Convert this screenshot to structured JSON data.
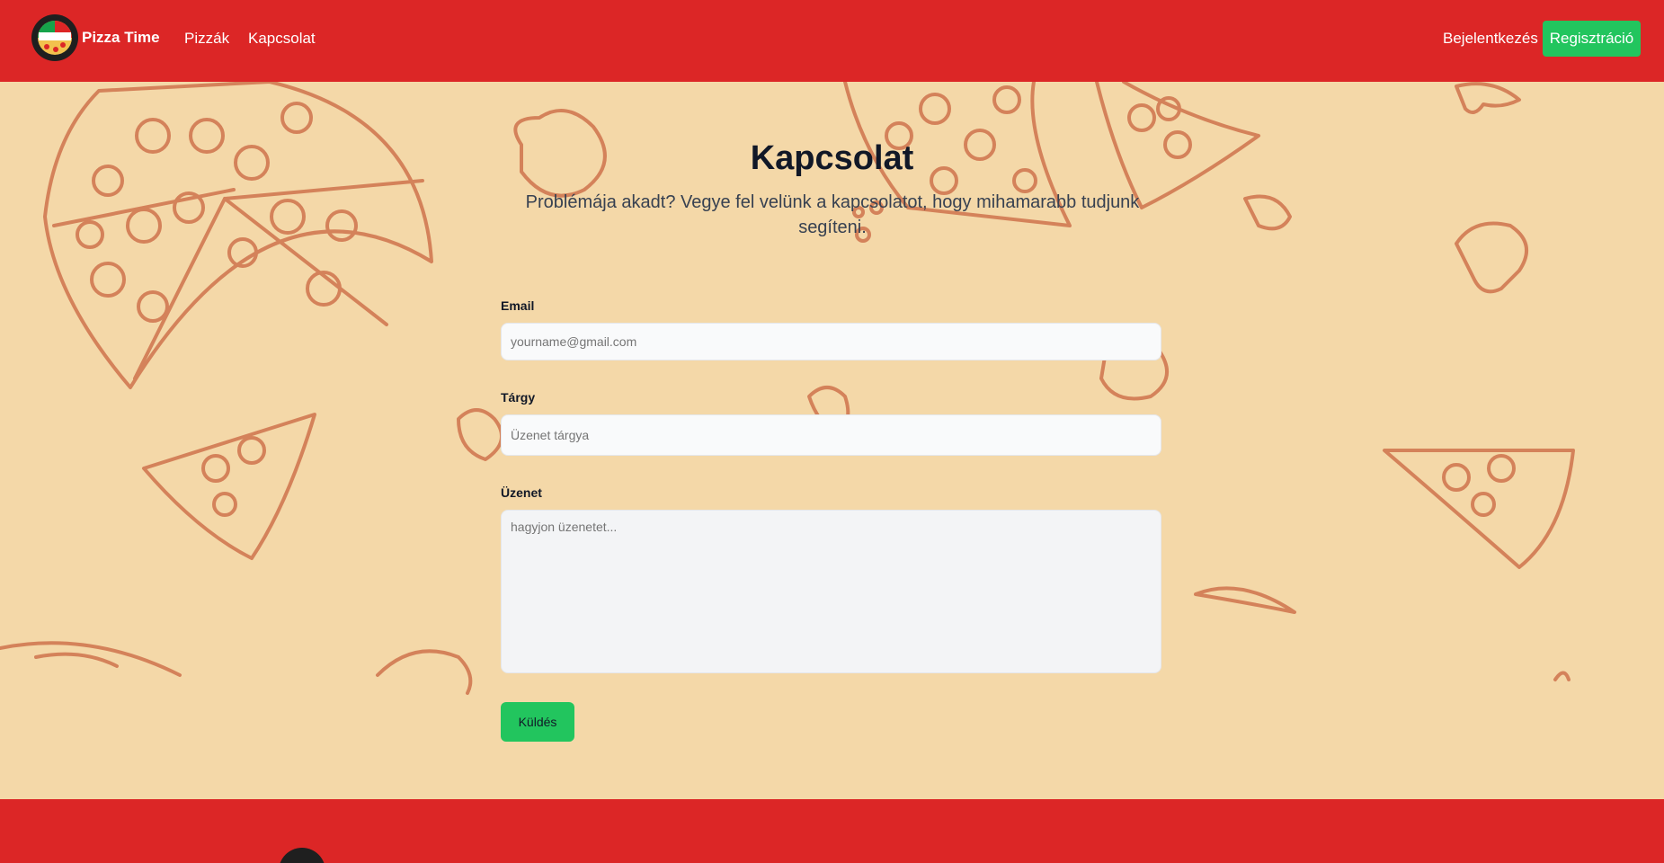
{
  "nav": {
    "brand": "Pizza Time",
    "logo_text": "PIZZA TIME",
    "links": [
      "Pizzák",
      "Kapcsolat"
    ],
    "login": "Bejelentkezés",
    "register": "Regisztráció"
  },
  "contact": {
    "title": "Kapcsolat",
    "subtitle": "Problémája akadt? Vegye fel velünk a kapcsolatot, hogy mihamarabb tudjunk segíteni.",
    "email_label": "Email",
    "email_placeholder": "yourname@gmail.com",
    "subject_label": "Tárgy",
    "subject_placeholder": "Üzenet tárgya",
    "message_label": "Üzenet",
    "message_placeholder": "hagyjon üzenetet...",
    "send": "Küldés"
  },
  "colors": {
    "navbar": "#dc2626",
    "background": "#f4d8a8",
    "accent_green": "#22c55e",
    "doodle": "#d4825a"
  },
  "icons": [
    "pizza-logo-icon"
  ]
}
